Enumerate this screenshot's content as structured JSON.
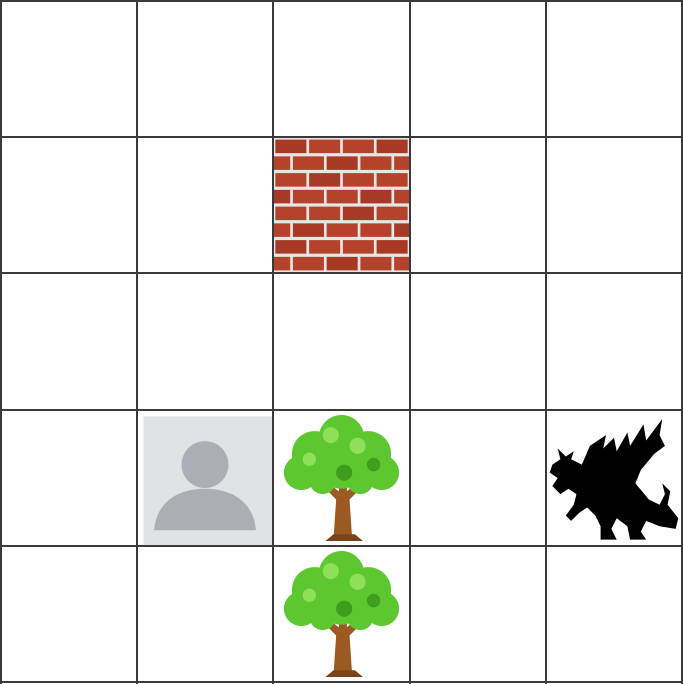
{
  "board": {
    "rows": 5,
    "cols": 5,
    "colors": {
      "grid_line": "#3a3a3a",
      "background": "#ffffff",
      "brick": "#b5432c",
      "mortar": "#e6e6e6",
      "foliage": "#5cc72e",
      "trunk": "#9c5a22",
      "avatar_bg": "#e1e2e4",
      "avatar_fg": "#abafb3",
      "dragon": "#000000"
    },
    "tiles": [
      {
        "row": 1,
        "col": 2,
        "kind": "wall",
        "icon": "brick-wall-icon"
      },
      {
        "row": 3,
        "col": 1,
        "kind": "player",
        "icon": "user-avatar-icon"
      },
      {
        "row": 3,
        "col": 2,
        "kind": "tree",
        "icon": "tree-icon"
      },
      {
        "row": 3,
        "col": 4,
        "kind": "enemy",
        "icon": "dragon-icon"
      },
      {
        "row": 4,
        "col": 2,
        "kind": "tree",
        "icon": "tree-icon"
      }
    ]
  }
}
